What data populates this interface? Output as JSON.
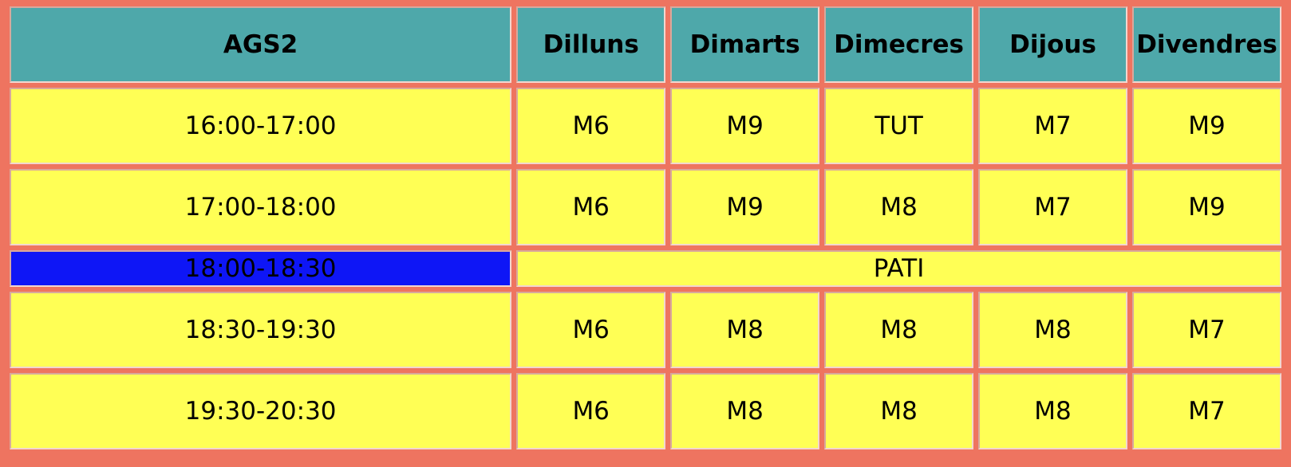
{
  "table": {
    "group_label": "AGS2",
    "days": [
      "Dilluns",
      "Dimarts",
      "Dimecres",
      "Dijous",
      "Divendres"
    ],
    "rows": [
      {
        "time": "16:00-17:00",
        "cells": [
          "M6",
          "M9",
          "TUT",
          "M7",
          "M9"
        ]
      },
      {
        "time": "17:00-18:00",
        "cells": [
          "M6",
          "M9",
          "M8",
          "M7",
          "M9"
        ]
      }
    ],
    "break_row": {
      "time": "18:00-18:30",
      "label": "PATI"
    },
    "rows_after": [
      {
        "time": "18:30-19:30",
        "cells": [
          "M6",
          "M8",
          "M8",
          "M8",
          "M7"
        ]
      },
      {
        "time": "19:30-20:30",
        "cells": [
          "M6",
          "M8",
          "M8",
          "M8",
          "M7"
        ]
      }
    ]
  },
  "colors": {
    "page_background": "#ee7460",
    "header_background": "#4ea8aa",
    "cell_background": "#ffff55",
    "break_time_background": "#0e16f6"
  }
}
